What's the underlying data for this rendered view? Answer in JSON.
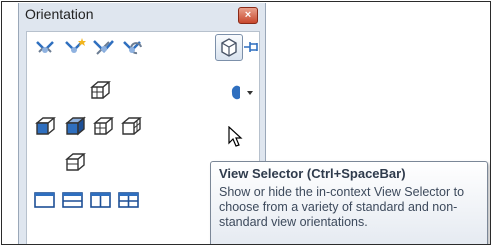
{
  "panel": {
    "title": "Orientation",
    "close_icon": "close-icon"
  },
  "toolbar_icons": [
    "new-view-icon",
    "update-view-icon",
    "normal-to-icon",
    "reset-view-icon",
    "view-selector-icon",
    "pin-icon"
  ],
  "view_icons": {
    "top": "top-view-icon",
    "row": [
      "left-view-icon",
      "front-view-icon",
      "right-view-icon",
      "back-view-icon"
    ],
    "bottom": "bottom-view-icon",
    "viewports": [
      "single-view-icon",
      "two-view-horizontal-icon",
      "two-view-vertical-icon",
      "four-view-icon"
    ]
  },
  "tooltip": {
    "title": "View Selector   (Ctrl+SpaceBar)",
    "body": "Show or hide the in-context View Selector to choose from a variety of standard and non-standard view orientations."
  },
  "colors": {
    "accent_blue": "#2f6fbf",
    "close_red": "#c8482d",
    "panel_bg": "#dfe6ef"
  }
}
